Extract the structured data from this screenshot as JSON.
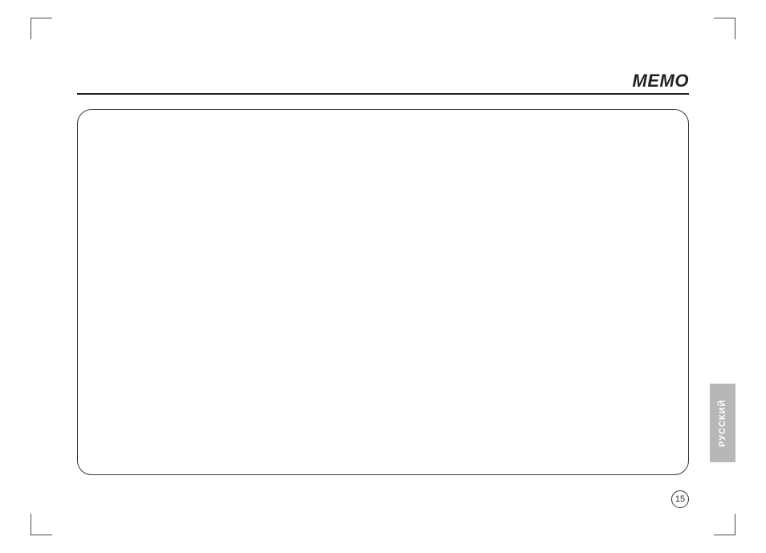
{
  "header": {
    "title": "MEMO"
  },
  "page_number": "15",
  "language_tab": "РУССКИЙ"
}
